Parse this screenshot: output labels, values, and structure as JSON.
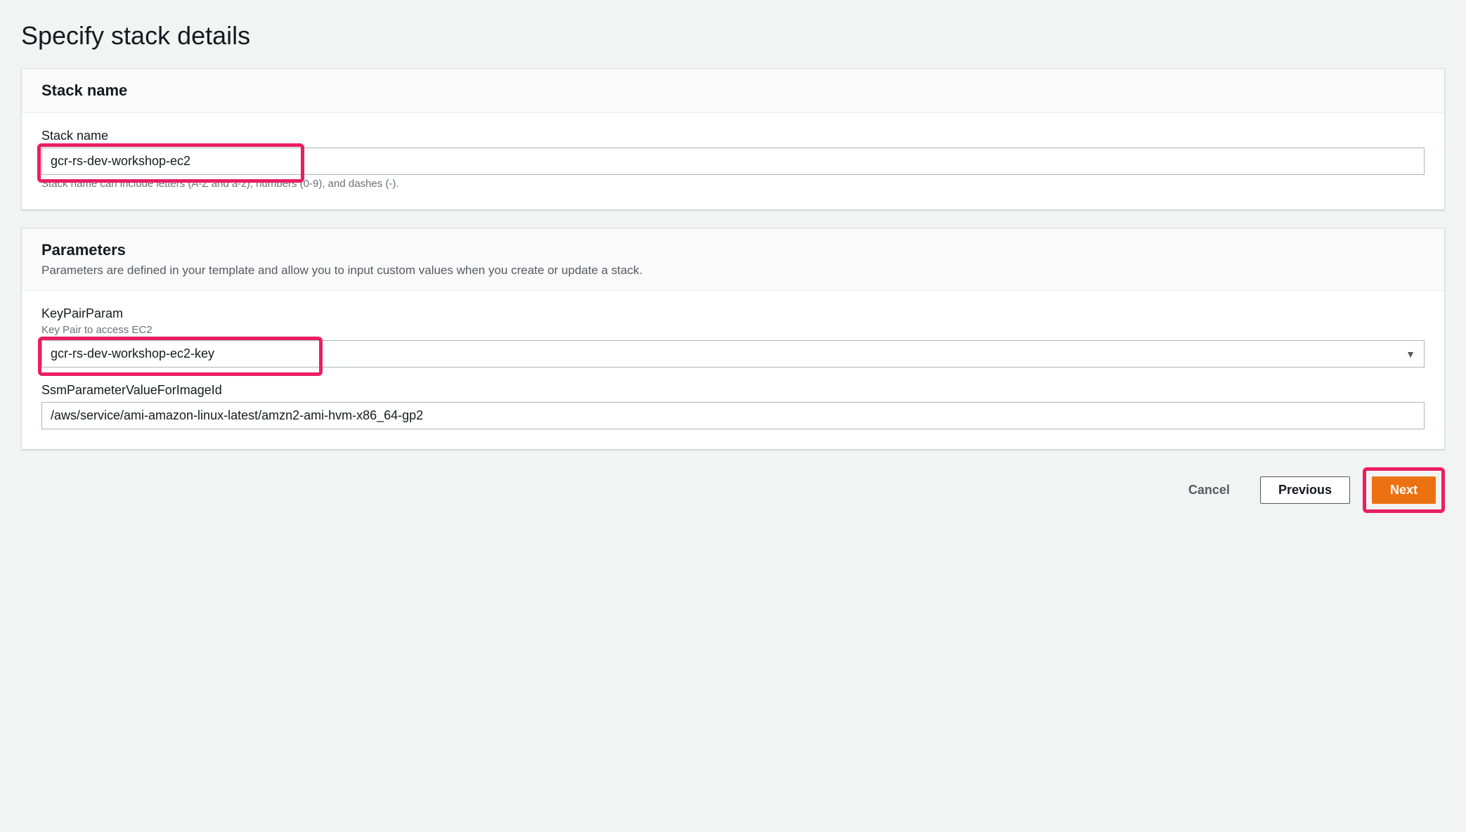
{
  "page_title": "Specify stack details",
  "stack_panel": {
    "header": "Stack name",
    "field_label": "Stack name",
    "value": "gcr-rs-dev-workshop-ec2",
    "hint": "Stack name can include letters (A-Z and a-z), numbers (0-9), and dashes (-)."
  },
  "params_panel": {
    "header": "Parameters",
    "subtitle": "Parameters are defined in your template and allow you to input custom values when you create or update a stack.",
    "keypair": {
      "label": "KeyPairParam",
      "desc": "Key Pair to access EC2",
      "value": "gcr-rs-dev-workshop-ec2-key"
    },
    "ssm": {
      "label": "SsmParameterValueForImageId",
      "value": "/aws/service/ami-amazon-linux-latest/amzn2-ami-hvm-x86_64-gp2"
    }
  },
  "footer": {
    "cancel": "Cancel",
    "previous": "Previous",
    "next": "Next"
  }
}
